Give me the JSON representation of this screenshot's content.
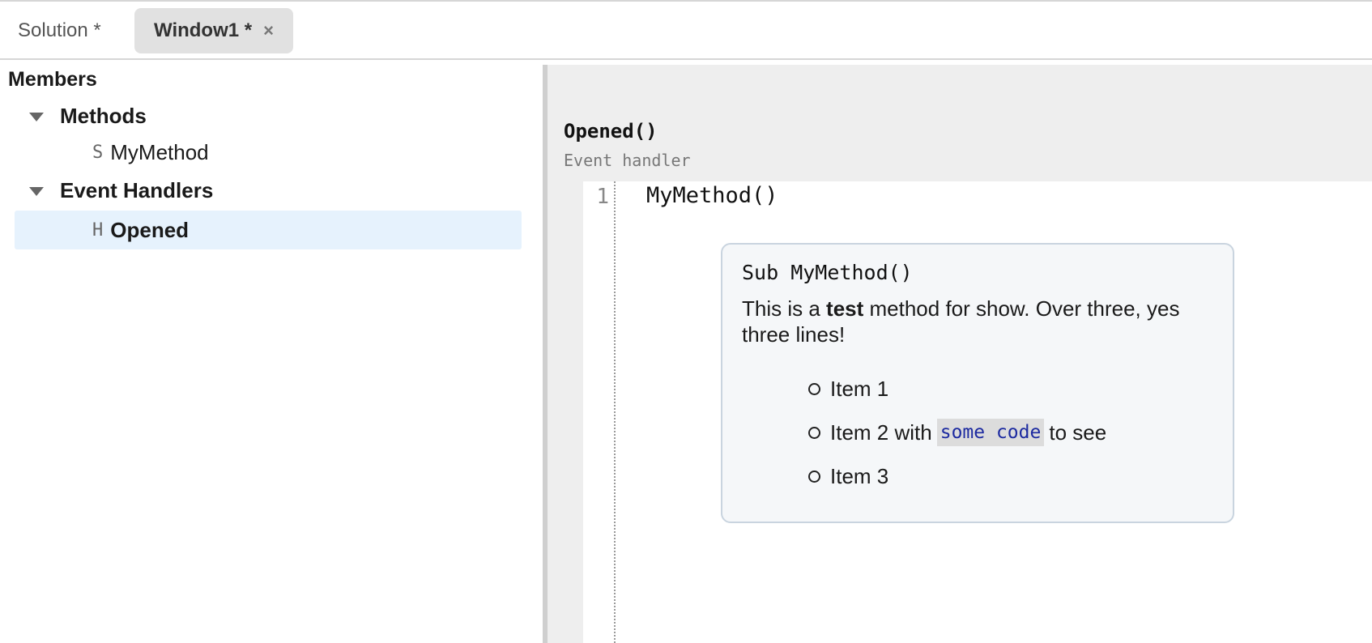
{
  "tabs": [
    {
      "label": "Solution *"
    },
    {
      "label": "Window1 *",
      "close": "×"
    }
  ],
  "members": {
    "title": "Members",
    "groups": [
      {
        "label": "Methods",
        "items": [
          {
            "kind": "S",
            "name": "MyMethod"
          }
        ]
      },
      {
        "label": "Event Handlers",
        "items": [
          {
            "kind": "H",
            "name": "Opened"
          }
        ]
      }
    ]
  },
  "editor": {
    "signature": "Opened()",
    "description": "Event handler",
    "lines": [
      {
        "number": "1",
        "code": "MyMethod()"
      }
    ]
  },
  "tooltip": {
    "signature": "Sub MyMethod()",
    "desc_before": "This is a ",
    "desc_bold": "test",
    "desc_after": " method for show. Over three, yes three lines!",
    "items": [
      {
        "text": "Item 1"
      },
      {
        "before": "Item 2 with",
        "code": "some code",
        "after": "to see"
      },
      {
        "text": "Item 3"
      }
    ]
  },
  "colors": {
    "selected_bg": "#e6f2fd",
    "active_tab_bg": "#e1e1e1",
    "code_text": "#1c2aa0",
    "tooltip_bg": "#f5f7f9"
  },
  "icons": {
    "expand": "triangle-down-icon",
    "list_bullet": "circle-bullet-icon",
    "tab_close": "close-icon"
  }
}
